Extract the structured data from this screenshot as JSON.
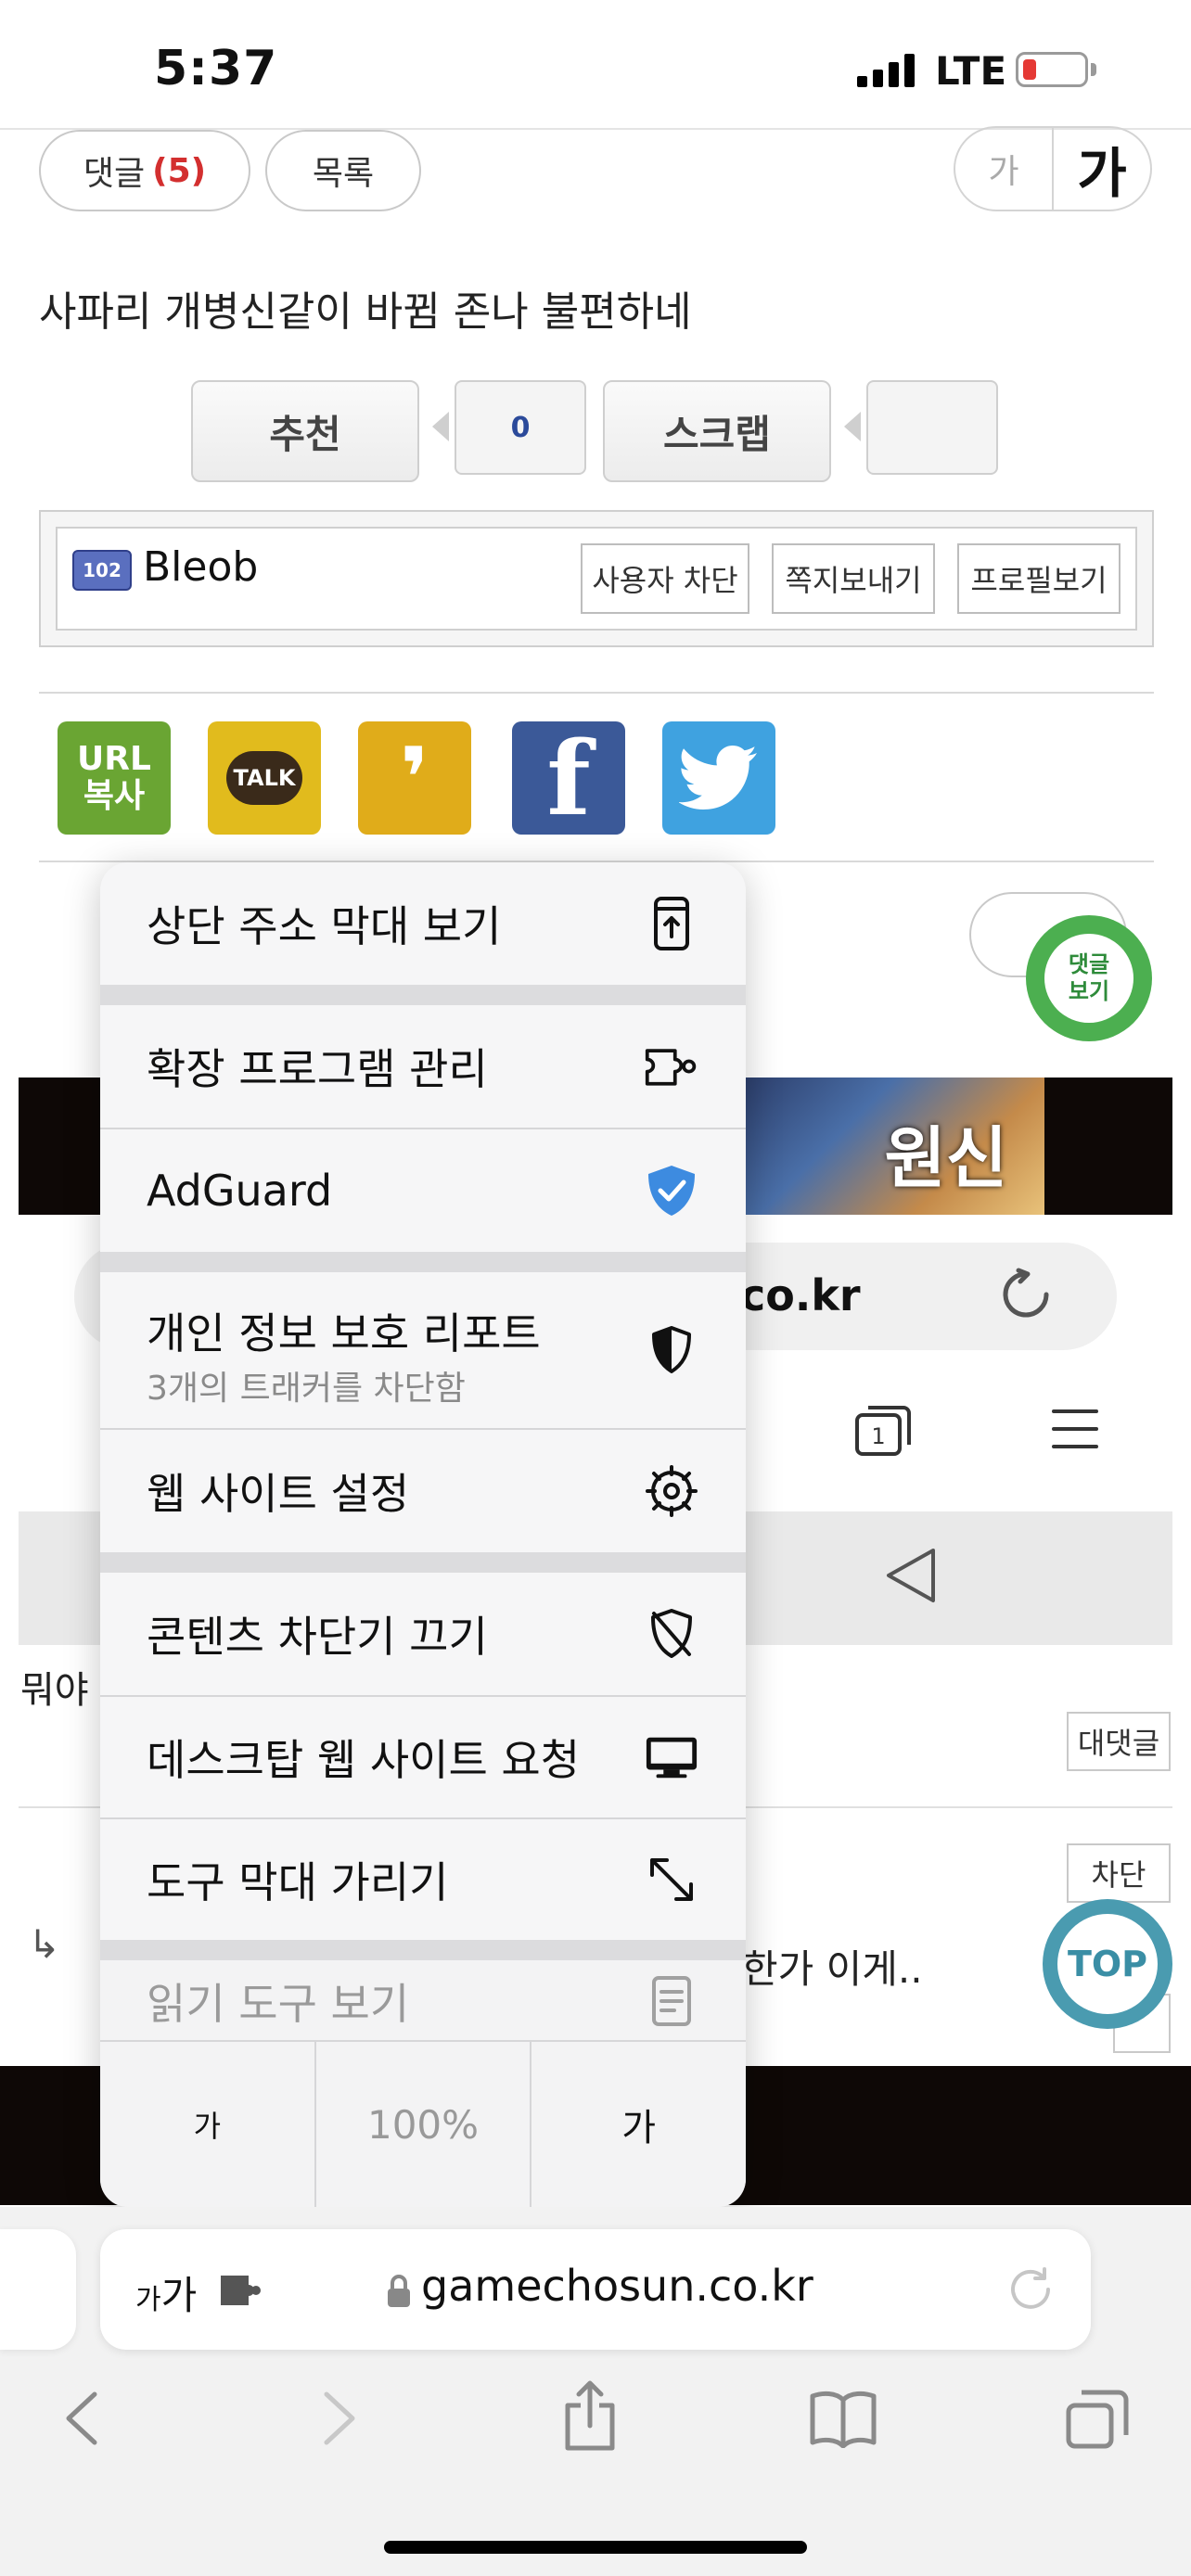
{
  "status_bar": {
    "time": "5:37",
    "network": "LTE"
  },
  "page": {
    "comment_button": "댓글",
    "comment_count": "(5)",
    "list_button": "목록",
    "font_small": "가",
    "font_large": "가",
    "post_text": "사파리 개병신같이 바뀜 존나 불편하네",
    "recommend_label": "추천",
    "recommend_count": "0",
    "scrap_label": "스크랩",
    "user_level": "102",
    "username": "Bleob",
    "user_buttons": [
      "사용자 차단",
      "쪽지보내기",
      "프로필보기"
    ],
    "share": {
      "url_line1": "URL",
      "url_line2": "복사",
      "talk": "TALK"
    },
    "comment_fab_line1": "댓글",
    "comment_fab_line2": "보기",
    "game_banner_title": "원신",
    "partial_url": "co.kr",
    "tab_count": "1",
    "comment_partial_1": "뭐야",
    "reply_button": "대댓글",
    "block_button": "차단",
    "comment_partial_2": "한가 이게..",
    "top_fab": "TOP"
  },
  "menu": {
    "items": [
      {
        "label": "상단 주소 막대 보기",
        "icon": "address-bar-top-icon"
      },
      {
        "label": "확장 프로그램 관리",
        "icon": "extension-puzzle-icon"
      },
      {
        "label": "AdGuard",
        "icon": "adguard-shield-icon"
      },
      {
        "label": "개인 정보 보호 리포트",
        "sublabel": "3개의 트래커를 차단함",
        "icon": "privacy-shield-icon"
      },
      {
        "label": "웹 사이트 설정",
        "icon": "gear-icon"
      },
      {
        "label": "콘텐츠 차단기 끄기",
        "icon": "shield-slash-icon"
      },
      {
        "label": "데스크탑 웹 사이트 요청",
        "icon": "desktop-icon"
      },
      {
        "label": "도구 막대 가리기",
        "icon": "expand-arrows-icon"
      },
      {
        "label": "읽기 도구 보기",
        "icon": "reader-icon"
      }
    ],
    "zoom": {
      "smaller": "가",
      "value": "100%",
      "larger": "가"
    }
  },
  "address_bar": {
    "aa_small": "가",
    "aa_large": "가",
    "url": "gamechosun.co.kr"
  },
  "colors": {
    "adguard": "#3d8be0",
    "comment_fab": "#4caf50",
    "top_fab": "#4a9bb0"
  }
}
